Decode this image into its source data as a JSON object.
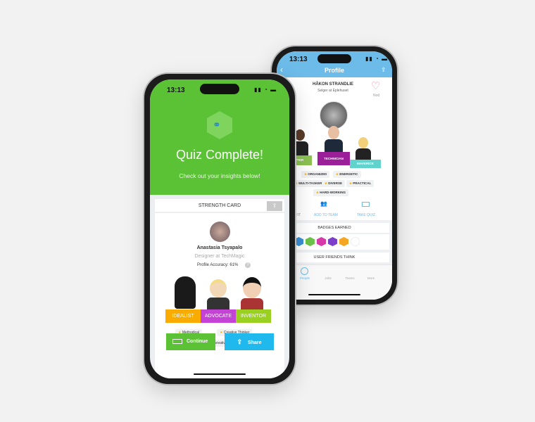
{
  "back_phone": {
    "status_time": "13:13",
    "header": {
      "title": "Profile",
      "back_icon": "chevron-left-icon",
      "share_icon": "share-icon"
    },
    "profile": {
      "name": "HÅKON STRANDLIE",
      "subtitle": "Selger at Eplehuset",
      "nod_label": "Nod"
    },
    "roles": [
      {
        "label": "GO GETTER",
        "color": "#8cc152"
      },
      {
        "label": "TECHNICIAN",
        "color": "#9b1f99"
      },
      {
        "label": "MAVERICK",
        "color": "#5fd3cc"
      }
    ],
    "tags": [
      "ORGANIZED",
      "ENERGETIC",
      "MULTI-TASKER",
      "DIVERSE",
      "PRACTICAL",
      "HARD-WORKING"
    ],
    "actions": [
      {
        "label": "CHECK FIT"
      },
      {
        "label": "ADD TO TEAM"
      },
      {
        "label": "TAKE QUIZ"
      }
    ],
    "badges_title": "BADGES EARNED",
    "badges": [
      {
        "icon": "hammer-icon",
        "color": "#3b8fd6"
      },
      {
        "icon": "binoculars-icon",
        "color": "#6cc24a"
      },
      {
        "icon": "magnifier-icon",
        "color": "#d63aa8"
      },
      {
        "icon": "search-icon",
        "color": "#7b3fc9"
      },
      {
        "icon": "bulb-icon",
        "color": "#f5a623"
      },
      {
        "icon": "empty-badge-icon",
        "color": "#ffffff"
      }
    ],
    "friends_title": "USER FRIENDS THINK",
    "tabbar": [
      {
        "label": "People",
        "active": true
      },
      {
        "label": "Jobs"
      },
      {
        "label": "Teams"
      },
      {
        "label": "More"
      }
    ]
  },
  "front_phone": {
    "status_time": "13:13",
    "title": "Quiz Complete!",
    "subtitle": "Check out your insights below!",
    "card_title": "STRENGTH CARD",
    "user": {
      "name": "Anastasia Tsyapalo",
      "role": "Designer at TechMagic",
      "accuracy": "Profile Accuracy: 61%"
    },
    "roles": [
      {
        "label": "IDEALIST",
        "color": "#f9ab00"
      },
      {
        "label": "ADVOCATE",
        "color": "#c442d6"
      },
      {
        "label": "INVENTOR",
        "color": "#9ad01f"
      }
    ],
    "traits": [
      "Methodical",
      "Creative Thinker",
      "Innovative"
    ],
    "continue_label": "Continue",
    "share_label": "Share",
    "accent": "#5bc236"
  }
}
